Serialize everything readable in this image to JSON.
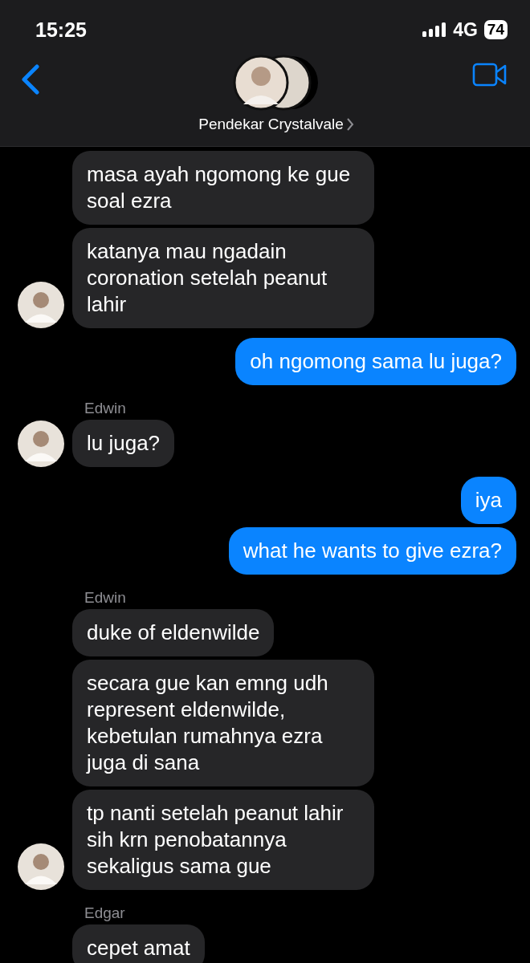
{
  "status_bar": {
    "time": "15:25",
    "network": "4G",
    "battery": "74"
  },
  "header": {
    "contact_name": "Pendekar Crystalvale"
  },
  "messages": [
    {
      "kind": "incoming",
      "text": "masa ayah ngomong ke gue soal ezra",
      "avatar": false
    },
    {
      "kind": "incoming",
      "text": "katanya mau ngadain coronation setelah peanut lahir",
      "avatar": true
    },
    {
      "kind": "outgoing",
      "text": "oh ngomong sama lu juga?"
    },
    {
      "kind": "sender",
      "text": "Edwin"
    },
    {
      "kind": "incoming",
      "text": "lu juga?",
      "avatar": true
    },
    {
      "kind": "outgoing",
      "text": "iya"
    },
    {
      "kind": "outgoing",
      "text": "what he wants to give ezra?"
    },
    {
      "kind": "sender",
      "text": "Edwin"
    },
    {
      "kind": "incoming",
      "text": "duke of eldenwilde",
      "avatar": false
    },
    {
      "kind": "incoming",
      "text": "secara gue kan emng udh represent eldenwilde, kebetulan rumahnya ezra juga di sana",
      "avatar": false
    },
    {
      "kind": "incoming",
      "text": "tp nanti setelah peanut lahir sih krn penobatannya sekaligus sama gue",
      "avatar": true
    },
    {
      "kind": "sender",
      "text": "Edgar"
    },
    {
      "kind": "incoming",
      "text": "cepet amat",
      "avatar": false
    }
  ]
}
